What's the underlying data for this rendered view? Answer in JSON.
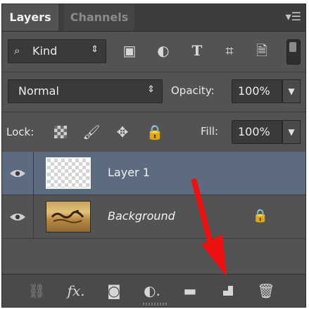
{
  "tabs": {
    "layers": "Layers",
    "channels": "Channels"
  },
  "filter": {
    "kind_label": "Kind"
  },
  "blend": {
    "mode": "Normal",
    "opacity_label": "Opacity:",
    "opacity_value": "100%"
  },
  "lock": {
    "label": "Lock:",
    "fill_label": "Fill:",
    "fill_value": "100%"
  },
  "layers": [
    {
      "name": "Layer 1",
      "selected": true
    },
    {
      "name": "Background",
      "selected": false
    }
  ],
  "colors": {
    "panel": "#535353",
    "selected_row": "#5d6b80",
    "arrow": "#ee1111"
  }
}
